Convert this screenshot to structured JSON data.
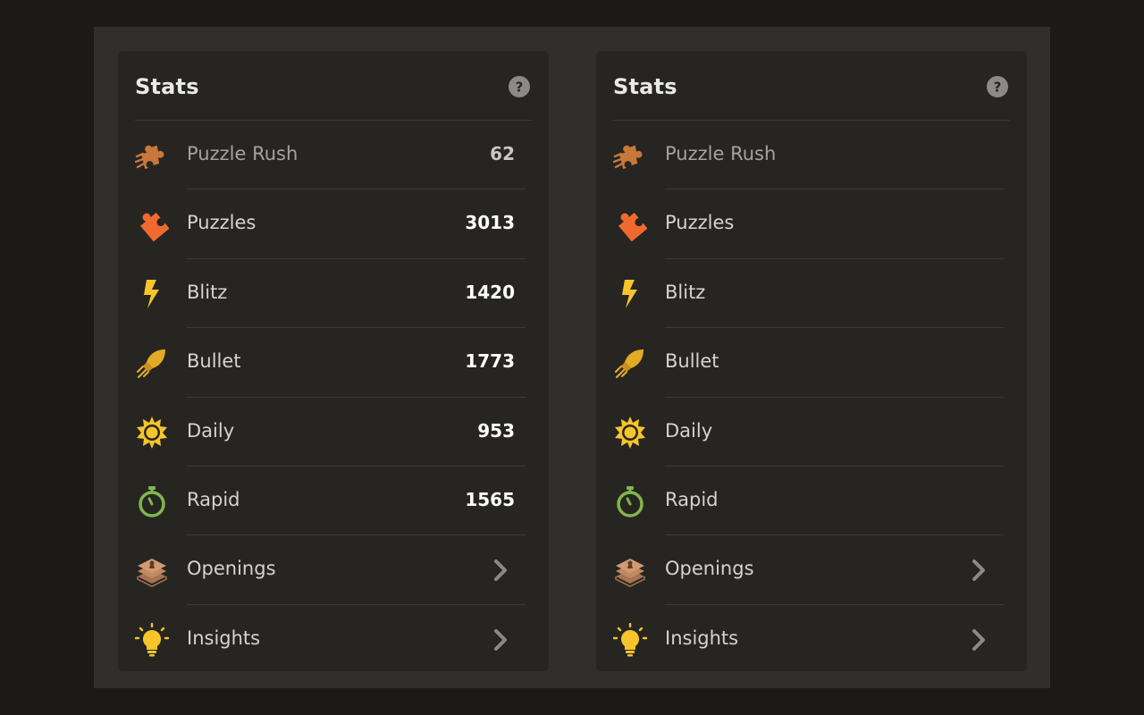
{
  "colors": {
    "page_background": "#1b1a19",
    "frame_background": "#312e2b",
    "card_background": "#262522",
    "puzzle_rush": "#c9783a",
    "puzzles": "#f06a2f",
    "blitz": "#f7c52a",
    "bullet": "#e3aa24",
    "daily": "#f7c52a",
    "rapid": "#81b64c",
    "openings": "#d09a72",
    "insights": "#f7c52a"
  },
  "left_panel": {
    "title": "Stats",
    "help_icon": "question-circle-icon",
    "rows": [
      {
        "label": "Puzzle Rush",
        "value": "62",
        "icon": "puzzle-rush-icon"
      },
      {
        "label": "Puzzles",
        "value": "3013",
        "icon": "puzzle-piece-icon"
      },
      {
        "label": "Blitz",
        "value": "1420",
        "icon": "lightning-icon"
      },
      {
        "label": "Bullet",
        "value": "1773",
        "icon": "bullet-icon"
      },
      {
        "label": "Daily",
        "value": "953",
        "icon": "sun-icon"
      },
      {
        "label": "Rapid",
        "value": "1565",
        "icon": "stopwatch-icon"
      },
      {
        "label": "Openings",
        "icon": "openings-book-icon",
        "chevron": "chevron-right-icon"
      },
      {
        "label": "Insights",
        "icon": "lightbulb-icon",
        "chevron": "chevron-right-icon"
      }
    ]
  },
  "right_panel": {
    "title": "Stats",
    "help_icon": "question-circle-icon",
    "rows": [
      {
        "label": "Puzzle Rush",
        "icon": "puzzle-rush-icon"
      },
      {
        "label": "Puzzles",
        "icon": "puzzle-piece-icon"
      },
      {
        "label": "Blitz",
        "icon": "lightning-icon"
      },
      {
        "label": "Bullet",
        "icon": "bullet-icon"
      },
      {
        "label": "Daily",
        "icon": "sun-icon"
      },
      {
        "label": "Rapid",
        "icon": "stopwatch-icon"
      },
      {
        "label": "Openings",
        "icon": "openings-book-icon",
        "chevron": "chevron-right-icon"
      },
      {
        "label": "Insights",
        "icon": "lightbulb-icon",
        "chevron": "chevron-right-icon"
      }
    ]
  }
}
